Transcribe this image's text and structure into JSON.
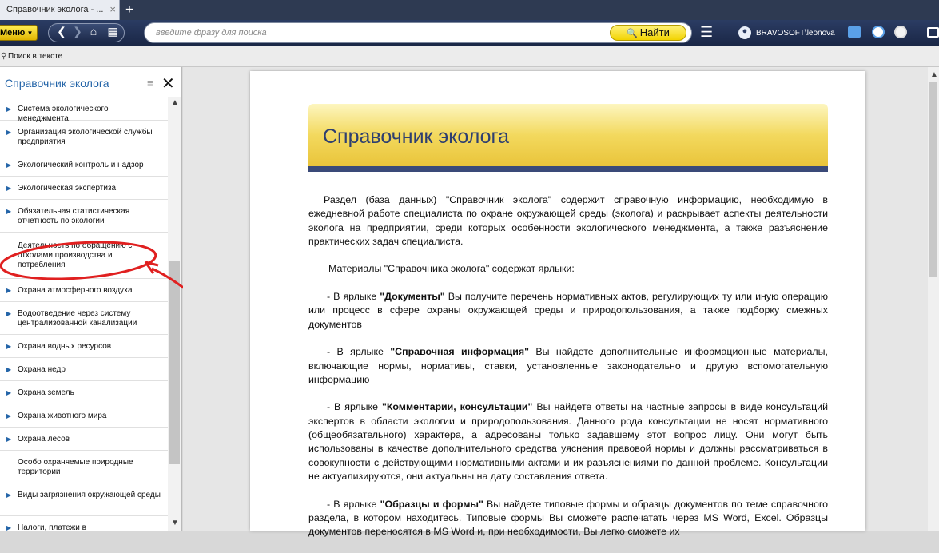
{
  "tab": {
    "title": "Справочник эколога - ...",
    "close": "×",
    "add": "+"
  },
  "toolbar": {
    "menu_label": "Меню",
    "search_placeholder": "введите фразу для поиска",
    "search_button": "Найти",
    "user": "BRAVOSOFT\\leonova"
  },
  "findbar": {
    "label": "Поиск в тексте"
  },
  "sidebar": {
    "title": "Справочник эколога",
    "items": [
      {
        "label": "Система экологического менеджмента",
        "bullet": true
      },
      {
        "label": "Организация экологической службы предприятия",
        "bullet": true
      },
      {
        "label": "Экологический контроль и надзор",
        "bullet": true
      },
      {
        "label": "Экологическая экспертиза",
        "bullet": true
      },
      {
        "label": "Обязательная статистическая отчетность по экологии",
        "bullet": true
      },
      {
        "label": "Деятельность по обращению с отходами производства и потребления",
        "bullet": false
      },
      {
        "label": "Охрана атмосферного воздуха",
        "bullet": true
      },
      {
        "label": "Водоотведение через систему централизованной канализации",
        "bullet": true
      },
      {
        "label": "Охрана водных ресурсов",
        "bullet": true
      },
      {
        "label": "Охрана недр",
        "bullet": true
      },
      {
        "label": "Охрана земель",
        "bullet": true
      },
      {
        "label": "Охрана животного мира",
        "bullet": true
      },
      {
        "label": "Охрана лесов",
        "bullet": true
      },
      {
        "label": "Особо охраняемые природные территории",
        "bullet": false
      },
      {
        "label": "Виды загрязнения окружающей среды",
        "bullet": true
      },
      {
        "label": "Налоги, платежи в",
        "bullet": true
      }
    ]
  },
  "document": {
    "title": "Справочник эколога",
    "intro": "Раздел (база данных) \"Справочник эколога\" содержит справочную информацию, необходимую в ежедневной работе специалиста по охране окружающей среды (эколога) и раскрывает аспекты деятельности эколога на предприятии, среди которых особенности экологического менеджмента, а также разъяснение практических задач специалиста.",
    "materials": "Материалы \"Справочника эколога\" содержат ярлыки:",
    "items": [
      {
        "prefix": "- В ярлыке ",
        "tag": "\"Документы\"",
        "text": " Вы получите перечень нормативных актов, регулирующих ту или иную операцию или процесс в сфере охраны окружающей среды и природопользования, а также подборку смежных документов"
      },
      {
        "prefix": "- В ярлыке ",
        "tag": "\"Справочная информация\"",
        "text": " Вы найдете дополнительные информационные материалы, включающие нормы, нормативы, ставки, установленные законодательно и другую вспомогательную информацию"
      },
      {
        "prefix": "- В ярлыке ",
        "tag": "\"Комментарии, консультации\"",
        "text": " Вы найдете ответы на частные запросы в виде консультаций экспертов в области экологии и природопользования. Данного рода консультации не носят нормативного (общеобязательного) характера, а адресованы только задавшему этот вопрос лицу. Они могут быть использованы в качестве дополнительного средства уяснения правовой нормы и должны рассматриваться в совокупности с действующими нормативными актами и их разъяснениями по данной проблеме. Консультации не актуализируются, они актуальны на дату составления ответа."
      },
      {
        "prefix": "- В ярлыке ",
        "tag": "\"Образцы и формы\"",
        "text": " Вы найдете типовые формы и образцы документов по теме справочного раздела, в котором находитесь. Типовые формы Вы сможете распечатать через MS Word, Excel. Образцы документов переносятся в MS Word и, при необходимости, Вы легко сможете их"
      }
    ]
  },
  "colors": {
    "accent": "#2364a8",
    "toolbar": "#1f2d4f",
    "header_gold": "#f3d95e",
    "annotation": "#e02020"
  }
}
